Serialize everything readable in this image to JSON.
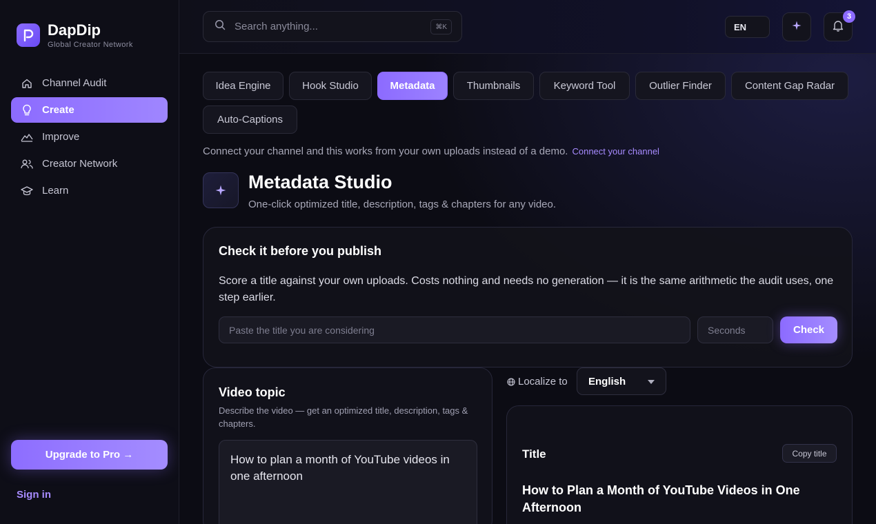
{
  "brand": {
    "name": "DapDip",
    "tagline": "Global Creator Network"
  },
  "sidebar": {
    "items": [
      {
        "label": "Channel Audit",
        "icon": "home-icon",
        "active": false
      },
      {
        "label": "Create",
        "icon": "lightbulb-icon",
        "active": true
      },
      {
        "label": "Improve",
        "icon": "mountain-icon",
        "active": false
      },
      {
        "label": "Creator Network",
        "icon": "users-icon",
        "active": false
      },
      {
        "label": "Learn",
        "icon": "graduation-cap-icon",
        "active": false
      }
    ],
    "upgrade_label": "Upgrade to Pro →",
    "signin_label": "Sign in"
  },
  "topbar": {
    "search_placeholder": "Search anything...",
    "search_shortcut": "⌘K",
    "language": "EN",
    "notifications_count": "3"
  },
  "tabs": [
    {
      "label": "Idea Engine",
      "active": false
    },
    {
      "label": "Hook Studio",
      "active": false
    },
    {
      "label": "Metadata",
      "active": true
    },
    {
      "label": "Thumbnails",
      "active": false
    },
    {
      "label": "Keyword Tool",
      "active": false
    },
    {
      "label": "Outlier Finder",
      "active": false
    },
    {
      "label": "Content Gap Radar",
      "active": false
    },
    {
      "label": "Auto-Captions",
      "active": false
    }
  ],
  "connect": {
    "text": "Connect your channel and this works from your own uploads instead of a demo.",
    "link": "Connect your channel"
  },
  "studio": {
    "title": "Metadata Studio",
    "subtitle": "One-click optimized title, description, tags & chapters for any video."
  },
  "check": {
    "title": "Check it before you publish",
    "description": "Score a title against your own uploads. Costs nothing and needs no generation — it is the same arithmetic the audit uses, one step earlier.",
    "title_placeholder": "Paste the title you are considering",
    "seconds_placeholder": "Seconds",
    "button_label": "Check"
  },
  "topic": {
    "title": "Video topic",
    "description": "Describe the video — get an optimized title, description, tags & chapters.",
    "value": "How to plan a month of YouTube videos in one afternoon"
  },
  "localize": {
    "label": "Localize to",
    "selected": "English"
  },
  "result": {
    "label": "Title",
    "copy_label": "Copy title",
    "value": "How to Plan a Month of YouTube Videos in One Afternoon"
  },
  "colors": {
    "accent": "#8c6bff",
    "background": "#0c0c14",
    "link": "#a78bff"
  }
}
